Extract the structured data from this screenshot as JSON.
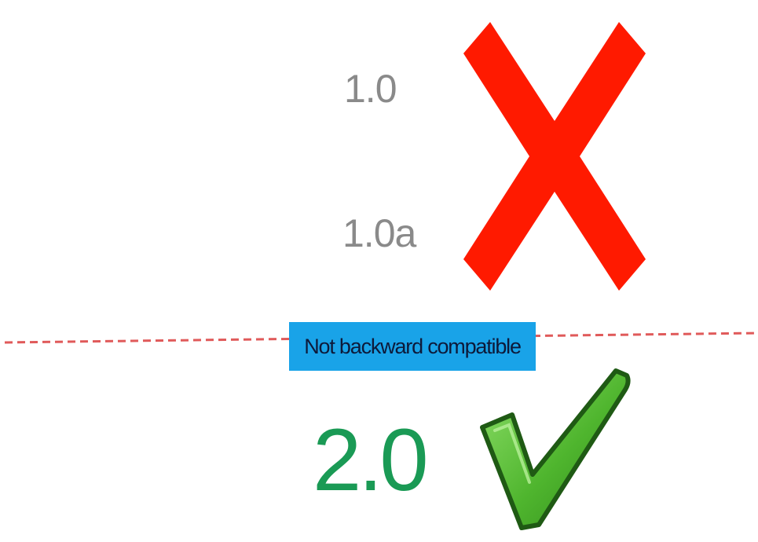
{
  "versions": {
    "v1": "1.0",
    "v1a": "1.0a",
    "v2": "2.0"
  },
  "badge": {
    "label": "Not backward compatible"
  },
  "icons": {
    "rejected": "cross-icon",
    "accepted": "checkmark-icon"
  },
  "colors": {
    "old_version_text": "#8a8a8a",
    "cross": "#ff1a00",
    "divider": "#e05a5a",
    "badge_bg": "#19a3e8",
    "badge_text": "#0d1a3a",
    "new_version_text": "#1a9a55",
    "check_fill": "#5cc23a",
    "check_outline": "#1f5a14"
  }
}
